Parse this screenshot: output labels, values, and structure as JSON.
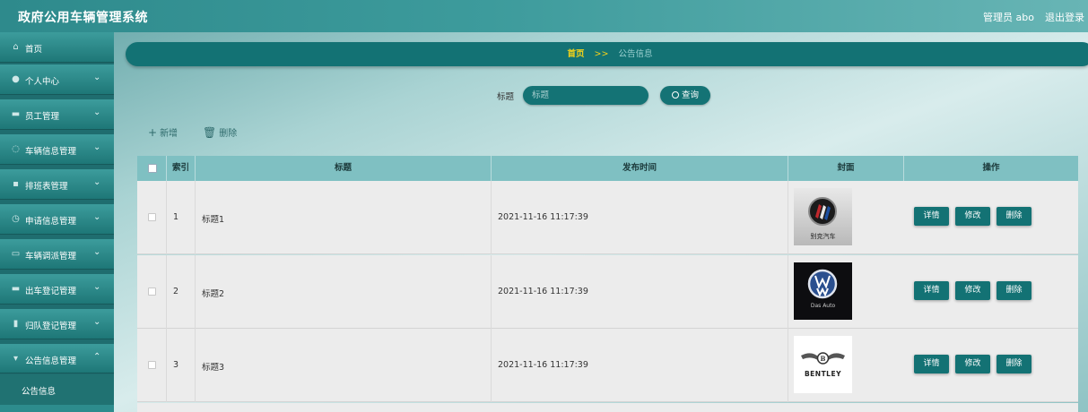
{
  "header": {
    "app_title": "政府公用车辆管理系统",
    "admin_label": "管理员 abo",
    "logout_label": "退出登录"
  },
  "sidebar": {
    "items": [
      {
        "label": "首页",
        "icon": "home-icon",
        "expandable": false
      },
      {
        "label": "个人中心",
        "icon": "user-icon",
        "expandable": true
      },
      {
        "label": "员工管理",
        "icon": "staff-icon",
        "expandable": true
      },
      {
        "label": "车辆信息管理",
        "icon": "power-icon",
        "expandable": true
      },
      {
        "label": "排班表管理",
        "icon": "schedule-icon",
        "expandable": true
      },
      {
        "label": "申请信息管理",
        "icon": "clock-icon",
        "expandable": true
      },
      {
        "label": "车辆调派管理",
        "icon": "message-icon",
        "expandable": true
      },
      {
        "label": "出车登记管理",
        "icon": "car-icon",
        "expandable": true
      },
      {
        "label": "归队登记管理",
        "icon": "chart-icon",
        "expandable": true
      },
      {
        "label": "公告信息管理",
        "icon": "notice-icon",
        "expandable": true,
        "expanded": true
      }
    ],
    "submenu": {
      "label": "公告信息"
    }
  },
  "breadcrumb": {
    "home": "首页",
    "separator": ">>",
    "current": "公告信息"
  },
  "search": {
    "label": "标题",
    "placeholder": "标题",
    "button_label": "查询"
  },
  "toolbar": {
    "add_label": "新增",
    "delete_label": "删除"
  },
  "table": {
    "columns": [
      "索引",
      "标题",
      "发布时间",
      "封面",
      "操作"
    ],
    "rows": [
      {
        "index": "1",
        "title": "标题1",
        "time": "2021-11-16 11:17:39",
        "cover": "buick-logo",
        "cover_text": "别克汽车"
      },
      {
        "index": "2",
        "title": "标题2",
        "time": "2021-11-16 11:17:39",
        "cover": "volkswagen-logo",
        "cover_text": "Das Auto"
      },
      {
        "index": "3",
        "title": "标题3",
        "time": "2021-11-16 11:17:39",
        "cover": "bentley-logo",
        "cover_text": "BENTLEY"
      }
    ],
    "actions": {
      "detail": "详情",
      "edit": "修改",
      "delete": "删除"
    }
  },
  "colors": {
    "accent": "#137274",
    "breadcrumb_highlight": "#f4d21a",
    "table_header": "#7fc0c2"
  }
}
